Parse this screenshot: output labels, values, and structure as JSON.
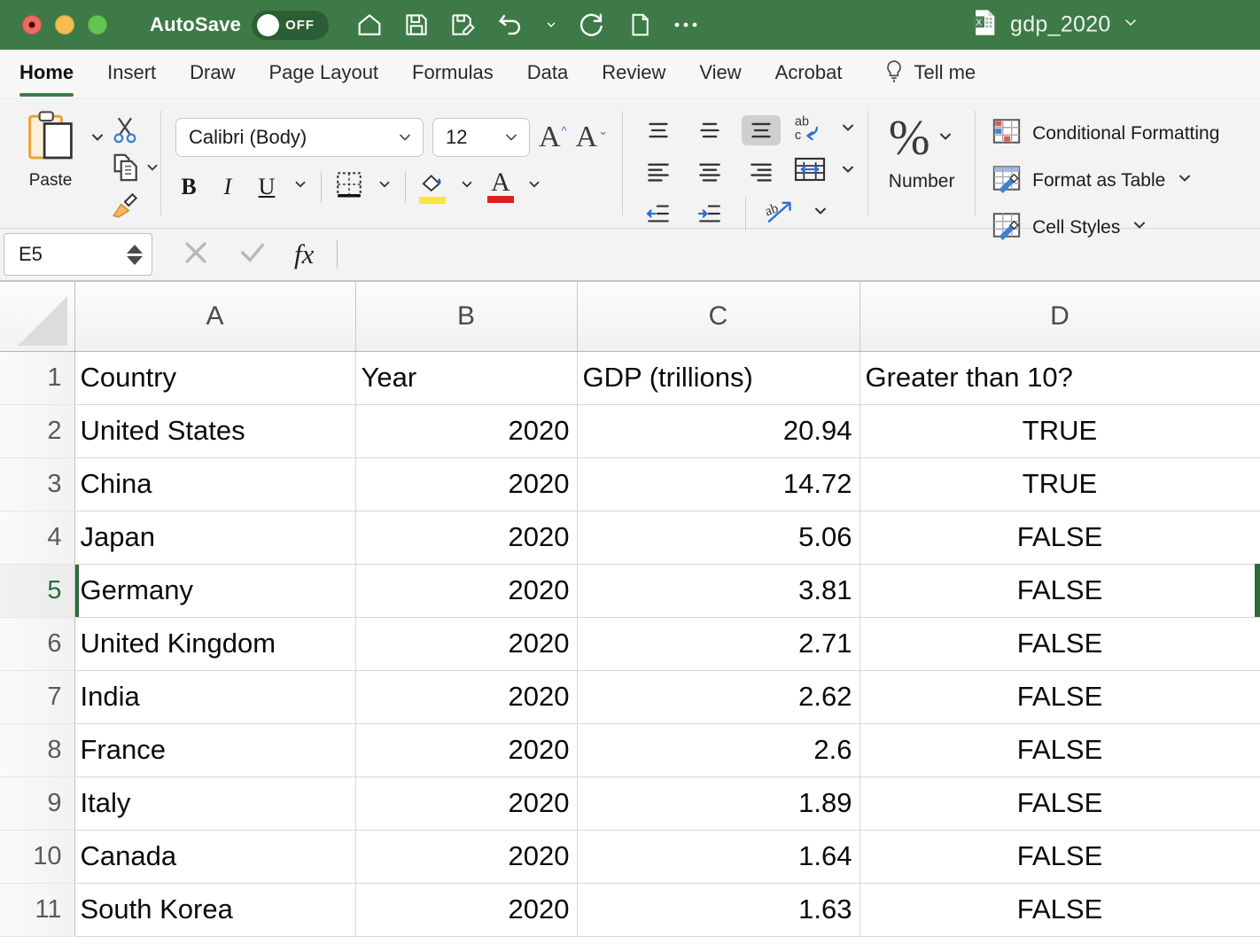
{
  "titlebar": {
    "autosave_label": "AutoSave",
    "autosave_state": "OFF",
    "document_title": "gdp_2020",
    "icons": [
      {
        "name": "home-icon"
      },
      {
        "name": "save-icon"
      },
      {
        "name": "save-as-icon"
      },
      {
        "name": "undo-icon"
      },
      {
        "name": "undo-dropdown-chevron-icon"
      },
      {
        "name": "redo-icon"
      },
      {
        "name": "new-document-icon"
      },
      {
        "name": "more-options-icon"
      }
    ]
  },
  "ribbon_tabs": {
    "items": [
      {
        "label": "Home",
        "active": true
      },
      {
        "label": "Insert",
        "active": false
      },
      {
        "label": "Draw",
        "active": false
      },
      {
        "label": "Page Layout",
        "active": false
      },
      {
        "label": "Formulas",
        "active": false
      },
      {
        "label": "Data",
        "active": false
      },
      {
        "label": "Review",
        "active": false
      },
      {
        "label": "View",
        "active": false
      },
      {
        "label": "Acrobat",
        "active": false
      }
    ],
    "tell_me_label": "Tell me"
  },
  "ribbon": {
    "clipboard": {
      "paste_label": "Paste",
      "cut_name": "cut-scissors-icon",
      "copy_name": "copy-icon",
      "format_painter_name": "format-painter-icon"
    },
    "font": {
      "font_name": "Calibri (Body)",
      "font_size": "12",
      "bold_label": "B",
      "italic_label": "I",
      "underline_label": "U",
      "grow_font_label": "A",
      "shrink_font_label": "A",
      "fill_color": "#f7e63a",
      "font_color": "#e02020"
    },
    "alignment": {
      "wrap_text_name": "wrap-text-icon",
      "merge_cells_name": "merge-and-center-icon",
      "orientation_name": "text-orientation-icon",
      "selected_align": "align-top-right"
    },
    "number": {
      "percent_symbol": "%",
      "label": "Number"
    },
    "styles": {
      "conditional_formatting_label": "Conditional Formatting",
      "format_as_table_label": "Format as Table",
      "cell_styles_label": "Cell Styles"
    }
  },
  "formula_bar": {
    "name_box_value": "E5",
    "formula_value": "",
    "cancel_name": "cancel-icon",
    "enter_name": "confirm-checkmark-icon",
    "fx_label": "fx"
  },
  "sheet": {
    "column_headers": [
      "A",
      "B",
      "C",
      "D"
    ],
    "row_numbers": [
      "1",
      "2",
      "3",
      "4",
      "5",
      "6",
      "7",
      "8",
      "9",
      "10",
      "11"
    ],
    "active_cell": "E5",
    "active_row": 5,
    "rows": [
      {
        "a": "Country",
        "b": "Year",
        "c": "GDP (trillions)",
        "d": "Greater than 10?",
        "header": true
      },
      {
        "a": "United States",
        "b": "2020",
        "c": "20.94",
        "d": "TRUE"
      },
      {
        "a": "China",
        "b": "2020",
        "c": "14.72",
        "d": "TRUE"
      },
      {
        "a": "Japan",
        "b": "2020",
        "c": "5.06",
        "d": "FALSE"
      },
      {
        "a": "Germany",
        "b": "2020",
        "c": "3.81",
        "d": "FALSE"
      },
      {
        "a": "United Kingdom",
        "b": "2020",
        "c": "2.71",
        "d": "FALSE"
      },
      {
        "a": "India",
        "b": "2020",
        "c": "2.62",
        "d": "FALSE"
      },
      {
        "a": "France",
        "b": "2020",
        "c": "2.6",
        "d": "FALSE"
      },
      {
        "a": "Italy",
        "b": "2020",
        "c": "1.89",
        "d": "FALSE"
      },
      {
        "a": "Canada",
        "b": "2020",
        "c": "1.64",
        "d": "FALSE"
      },
      {
        "a": "South Korea",
        "b": "2020",
        "c": "1.63",
        "d": "FALSE"
      }
    ]
  },
  "colors": {
    "titlebar_green": "#3d7a47",
    "accent_green": "#2b6b39",
    "ribbon_bg": "#f3f3f3"
  }
}
